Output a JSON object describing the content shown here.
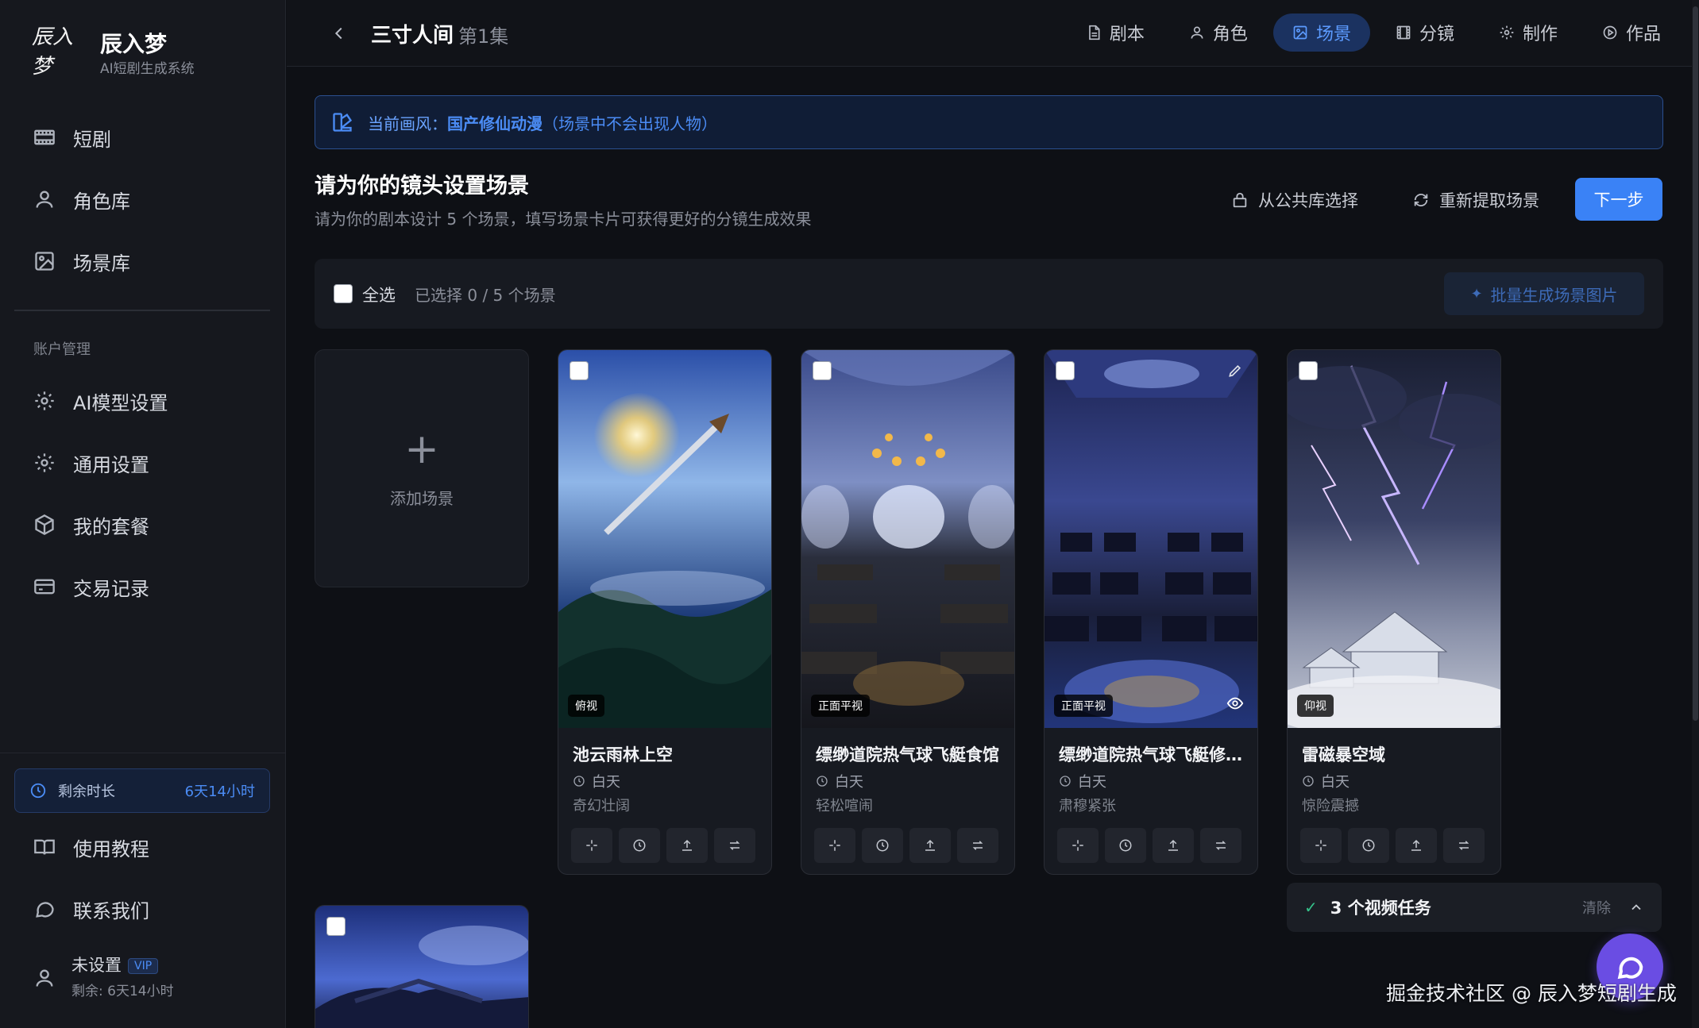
{
  "app": {
    "logo_mark": "辰入梦",
    "title": "辰入梦",
    "subtitle": "AI短剧生成系统"
  },
  "sidebar": {
    "nav": [
      {
        "label": "短剧",
        "icon": "film-icon"
      },
      {
        "label": "角色库",
        "icon": "user-icon"
      },
      {
        "label": "场景库",
        "icon": "image-icon"
      }
    ],
    "section_label": "账户管理",
    "account": [
      {
        "label": "AI模型设置",
        "icon": "gear-icon"
      },
      {
        "label": "通用设置",
        "icon": "gear-icon"
      },
      {
        "label": "我的套餐",
        "icon": "package-icon"
      },
      {
        "label": "交易记录",
        "icon": "card-icon"
      }
    ],
    "time_remaining": {
      "label": "剩余时长",
      "value": "6天14小时"
    },
    "bottom": [
      {
        "label": "使用教程",
        "icon": "book-icon"
      },
      {
        "label": "联系我们",
        "icon": "chat-icon"
      }
    ],
    "user": {
      "name": "未设置",
      "badge": "VIP",
      "remaining": "剩余: 6天14小时"
    }
  },
  "topbar": {
    "project_title": "三寸人间",
    "episode": "第1集",
    "tabs": [
      {
        "label": "剧本",
        "icon": "document-icon",
        "active": false
      },
      {
        "label": "角色",
        "icon": "user-icon",
        "active": false
      },
      {
        "label": "场景",
        "icon": "image-icon",
        "active": true
      },
      {
        "label": "分镜",
        "icon": "film-icon",
        "active": false
      },
      {
        "label": "制作",
        "icon": "gear-icon",
        "active": false
      },
      {
        "label": "作品",
        "icon": "play-icon",
        "active": false
      }
    ]
  },
  "banner": {
    "prefix": "当前画风：",
    "style": "国产修仙动漫",
    "note": "（场景中不会出现人物）"
  },
  "header": {
    "title": "请为你的镜头设置场景",
    "subtitle": "请为你的剧本设计 5 个场景，填写场景卡片可获得更好的分镜生成效果",
    "public_library": "从公共库选择",
    "re_extract": "重新提取场景",
    "next": "下一步"
  },
  "selection": {
    "select_all": "全选",
    "selected_text": "已选择 0 / 5 个场景",
    "batch_generate": "批量生成场景图片"
  },
  "add_card": {
    "label": "添加场景"
  },
  "scenes": [
    {
      "name": "池云雨林上空",
      "view": "俯视",
      "time": "白天",
      "mood": "奇幻壮阔"
    },
    {
      "name": "缥缈道院热气球飞艇食馆",
      "view": "正面平视",
      "time": "白天",
      "mood": "轻松喧闹"
    },
    {
      "name": "缥缈道院热气球飞艇修炼室",
      "view": "正面平视",
      "time": "白天",
      "mood": "肃穆紧张"
    },
    {
      "name": "雷磁暴空域",
      "view": "仰视",
      "time": "白天",
      "mood": "惊险震撼"
    }
  ],
  "tasks": {
    "label": "3 个视频任务",
    "clear": "清除"
  },
  "watermark": "掘金技术社区 @ 辰入梦短剧生成",
  "colors": {
    "accent": "#3a82f6",
    "active_tab_bg": "#1b3260",
    "sidebar_bg": "#16181e",
    "page_bg": "#0e1015",
    "success": "#35c28a",
    "chat_button": "#6a4de3"
  }
}
